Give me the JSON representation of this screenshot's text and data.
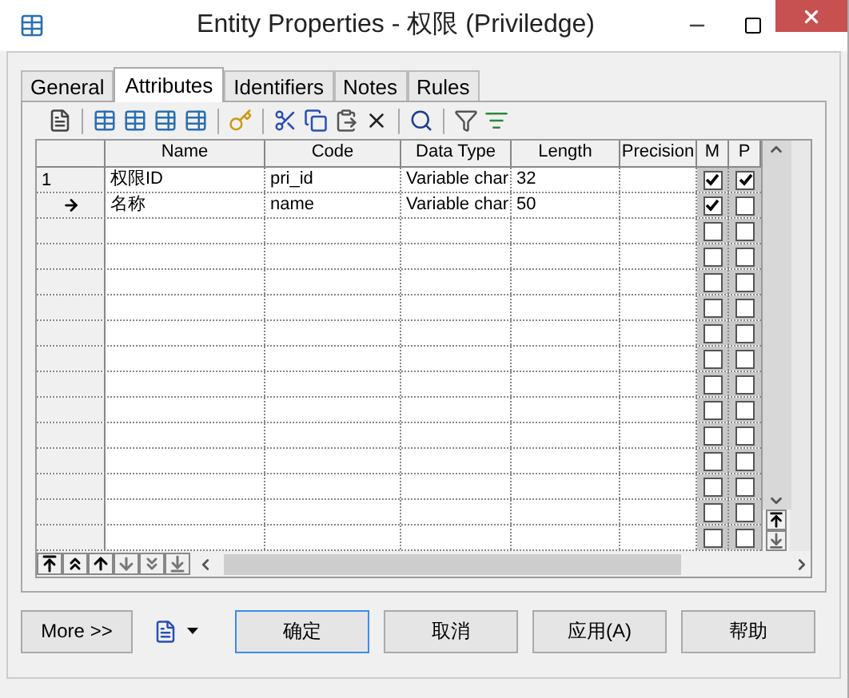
{
  "window": {
    "title": "Entity Properties - 权限 (Priviledge)"
  },
  "tabs": [
    {
      "label": "General",
      "selected": false
    },
    {
      "label": "Attributes",
      "selected": true
    },
    {
      "label": "Identifiers",
      "selected": false
    },
    {
      "label": "Notes",
      "selected": false
    },
    {
      "label": "Rules",
      "selected": false
    }
  ],
  "table": {
    "columns": [
      "Name",
      "Code",
      "Data Type",
      "Length",
      "Precision",
      "M",
      "P"
    ],
    "rows": [
      {
        "header": "1",
        "current": false,
        "name": "权限ID",
        "code": "pri_id",
        "data_type": "Variable char",
        "length": "32",
        "m": true,
        "p": true
      },
      {
        "current": true,
        "name": "名称",
        "code": "name",
        "data_type": "Variable char",
        "length": "50",
        "m": true,
        "p": false
      }
    ],
    "empty_rows": [
      {
        "m": false,
        "p": false
      },
      {
        "m": false,
        "p": false
      },
      {
        "m": false,
        "p": false
      },
      {
        "m": false,
        "p": false
      },
      {
        "m": false,
        "p": false
      },
      {
        "m": false,
        "p": false
      },
      {
        "m": false,
        "p": false
      },
      {
        "m": false,
        "p": false
      },
      {
        "m": false,
        "p": false
      },
      {
        "m": false,
        "p": false
      },
      {
        "m": false,
        "p": false
      },
      {
        "m": false,
        "p": false
      },
      {
        "m": false,
        "p": false
      }
    ]
  },
  "buttons": [
    {
      "label": "More >>",
      "selected": false
    },
    {
      "label": "确定",
      "selected": true
    },
    {
      "label": "取消",
      "selected": false
    },
    {
      "label": "应用(A)",
      "selected": false
    },
    {
      "label": "帮助",
      "selected": false
    }
  ]
}
